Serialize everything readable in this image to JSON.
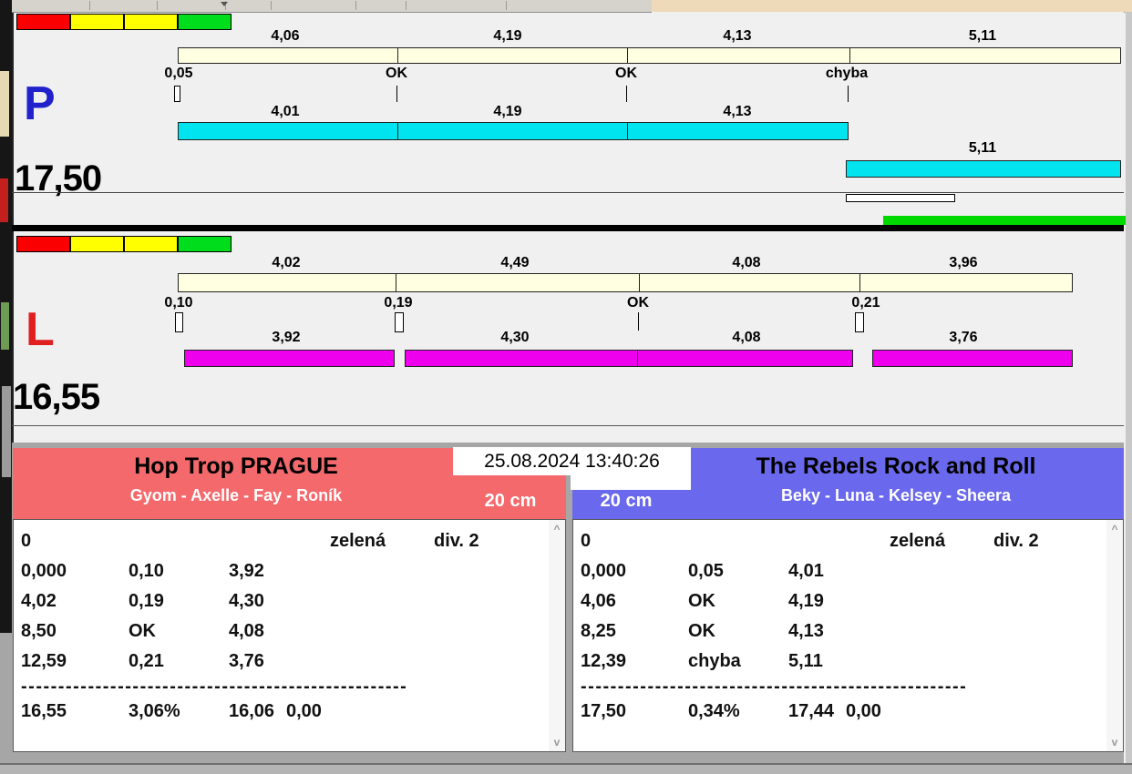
{
  "judge_p": {
    "letter": "P",
    "total": "17,50",
    "segment_labels": [
      "4,06",
      "4,19",
      "4,13",
      "5,11"
    ],
    "check_labels": [
      "0,05",
      "OK",
      "OK",
      "chyba"
    ],
    "time_labels": [
      "4,01",
      "4,19",
      "4,13"
    ],
    "overflow_label": "5,11"
  },
  "judge_l": {
    "letter": "L",
    "total": "16,55",
    "segment_labels": [
      "4,02",
      "4,49",
      "4,08",
      "3,96"
    ],
    "check_labels": [
      "0,10",
      "0,19",
      "OK",
      "0,21"
    ],
    "time_labels": [
      "3,92",
      "4,30",
      "4,08",
      "3,76"
    ]
  },
  "clock": {
    "datetime": "25.08.2024 13:40:26"
  },
  "teams": {
    "left": {
      "name": "Hop Trop PRAGUE",
      "members": "Gyom - Axelle - Fay - Roník",
      "height": "20 cm",
      "color": "#f4696c",
      "log": {
        "rows": [
          {
            "c1": "0",
            "c4": "zelená",
            "c5": "div. 2"
          },
          {
            "c1": "0,000",
            "c2": "0,10",
            "c3": "3,92"
          },
          {
            "c1": "4,02",
            "c2": "0,19",
            "c3": "4,30"
          },
          {
            "c1": "8,50",
            "c2": "OK",
            "c3": "4,08"
          },
          {
            "c1": "12,59",
            "c2": "0,21",
            "c3": "3,76"
          }
        ],
        "divider": "----------------------------------------------------",
        "totals": {
          "c1": "16,55",
          "c2": "3,06%",
          "c3": "16,06",
          "c4": "0,00"
        }
      }
    },
    "right": {
      "name": "The Rebels Rock and Roll",
      "members": "Beky - Luna - Kelsey - Sheera",
      "height": "20 cm",
      "color": "#6a68ec",
      "log": {
        "rows": [
          {
            "c1": "0",
            "c4": "zelená",
            "c5": "div. 2"
          },
          {
            "c1": "0,000",
            "c2": "0,05",
            "c3": "4,01"
          },
          {
            "c1": "4,06",
            "c2": "OK",
            "c3": "4,19"
          },
          {
            "c1": "8,25",
            "c2": "OK",
            "c3": "4,13"
          },
          {
            "c1": "12,39",
            "c2": "chyba",
            "c3": "5,11"
          }
        ],
        "divider": "----------------------------------------------------",
        "totals": {
          "c1": "17,50",
          "c2": "0,34%",
          "c3": "17,44",
          "c4": "0,00"
        }
      }
    }
  },
  "colors": {
    "cream_bar": "#ffffe1",
    "cyan_bar": "#00e4f0",
    "magenta_bar": "#ee00ee",
    "green_bar": "#00d900",
    "status_red": "#fa0000",
    "status_yellow": "#ffff00",
    "status_green": "#00dd1c",
    "judge_p_blue": "#2222cc",
    "judge_l_red": "#e02020",
    "team_left": "#f4696c",
    "team_right": "#6a68ec"
  },
  "icons": {
    "scroll_up": "^",
    "scroll_down": "v"
  }
}
